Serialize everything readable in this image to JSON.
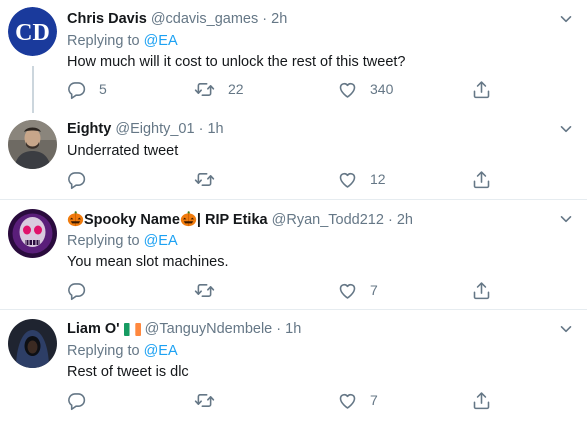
{
  "replies": [
    {
      "name": "Chris Davis",
      "handle": "@cdavis_games",
      "time": "2h",
      "replying_prefix": "Replying to",
      "replying_to": "@EA",
      "text": "How much will it cost to unlock the rest of this tweet?",
      "replies": "5",
      "retweets": "22",
      "likes": "340",
      "avatar_initials": "CD"
    },
    {
      "name": "Eighty",
      "handle": "@Eighty_01",
      "time": "1h",
      "text": "Underrated tweet",
      "replies": "",
      "retweets": "",
      "likes": "12"
    },
    {
      "name_part1": "Spooky Name",
      "name_part2": "| RIP Etika",
      "handle": "@Ryan_Todd212",
      "time": "2h",
      "replying_prefix": "Replying to",
      "replying_to": "@EA",
      "text": "You mean slot machines.",
      "replies": "",
      "retweets": "",
      "likes": "7"
    },
    {
      "name": "Liam O'",
      "handle": "@TanguyNdembele",
      "time": "1h",
      "replying_prefix": "Replying to",
      "replying_to": "@EA",
      "text": "Rest of tweet is dlc",
      "replies": "",
      "retweets": "",
      "likes": "7"
    }
  ],
  "separator": "·",
  "icons": {
    "reply": "reply-icon",
    "retweet": "retweet-icon",
    "like": "heart-icon",
    "share": "share-icon",
    "caret": "chevron-down-icon",
    "pumpkin": "jack-o-lantern-emoji",
    "flag": "ireland-flag-emoji"
  },
  "colors": {
    "link": "#1da1f2",
    "secondary_text": "#657786",
    "primary_text": "#14171a",
    "divider": "#e6ecf0",
    "thread_line": "#ccd6dd",
    "cd_logo": "#1a3a9c"
  }
}
